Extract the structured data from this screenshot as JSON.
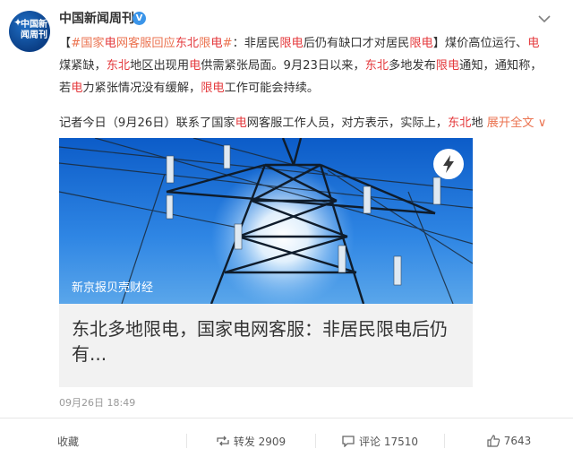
{
  "author": {
    "avatar_text": "中国新闻周刊",
    "name": "中国新闻周刊",
    "verified_icon": "verified-badge-icon"
  },
  "post": {
    "segments": [
      {
        "text": "【",
        "style": "normal"
      },
      {
        "text": "#国家",
        "style": "topic"
      },
      {
        "text": "电",
        "style": "red"
      },
      {
        "text": "网客服回应",
        "style": "topic"
      },
      {
        "text": "东北",
        "style": "red"
      },
      {
        "text": "限",
        "style": "topic"
      },
      {
        "text": "电",
        "style": "red"
      },
      {
        "text": "#",
        "style": "topic"
      },
      {
        "text": "：非居民",
        "style": "normal"
      },
      {
        "text": "限电",
        "style": "red"
      },
      {
        "text": "后仍有缺口才对居民",
        "style": "normal"
      },
      {
        "text": "限电",
        "style": "red"
      },
      {
        "text": "】煤价高位运行、",
        "style": "normal"
      },
      {
        "text": "电",
        "style": "red"
      },
      {
        "text": "煤紧缺，",
        "style": "normal"
      },
      {
        "text": "东北",
        "style": "red"
      },
      {
        "text": "地区出现用",
        "style": "normal"
      },
      {
        "text": "电",
        "style": "red"
      },
      {
        "text": "供需紧张局面。9月23日以来，",
        "style": "normal"
      },
      {
        "text": "东北",
        "style": "red"
      },
      {
        "text": "多地发布",
        "style": "normal"
      },
      {
        "text": "限电",
        "style": "red"
      },
      {
        "text": "通知，通知称，若",
        "style": "normal"
      },
      {
        "text": "电",
        "style": "red"
      },
      {
        "text": "力紧张情况没有缓解，",
        "style": "normal"
      },
      {
        "text": "限电",
        "style": "red"
      },
      {
        "text": "工作可能会持续。",
        "style": "normal"
      }
    ],
    "para2_segments": [
      {
        "text": "记者今日（9月26日）联系了国家",
        "style": "normal"
      },
      {
        "text": "电",
        "style": "red"
      },
      {
        "text": "网客服工作人员，对方表示，实际上，",
        "style": "normal"
      },
      {
        "text": "东北",
        "style": "red"
      },
      {
        "text": "地 ",
        "style": "normal"
      }
    ],
    "expand_label": "展开全文",
    "expand_icon": "chevron-down-icon"
  },
  "media": {
    "photo_caption": "新京报贝壳财经",
    "badge_icon": "lightning-icon",
    "headline": "东北多地限电，国家电网客服：非居民限电后仍有..."
  },
  "timestamp": "09月26日 18:49",
  "actions": {
    "favorite_label": "收藏",
    "repost_icon": "repost-icon",
    "repost_label": "转发 2909",
    "comment_icon": "comment-icon",
    "comment_label": "评论 17510",
    "like_icon": "thumbs-up-icon",
    "like_label": "7643"
  },
  "colors": {
    "accent_red": "#e4393c",
    "topic_orange": "#eb7350",
    "verified_blue": "#3b95e9",
    "avatar_blue": "#0b3f86"
  }
}
